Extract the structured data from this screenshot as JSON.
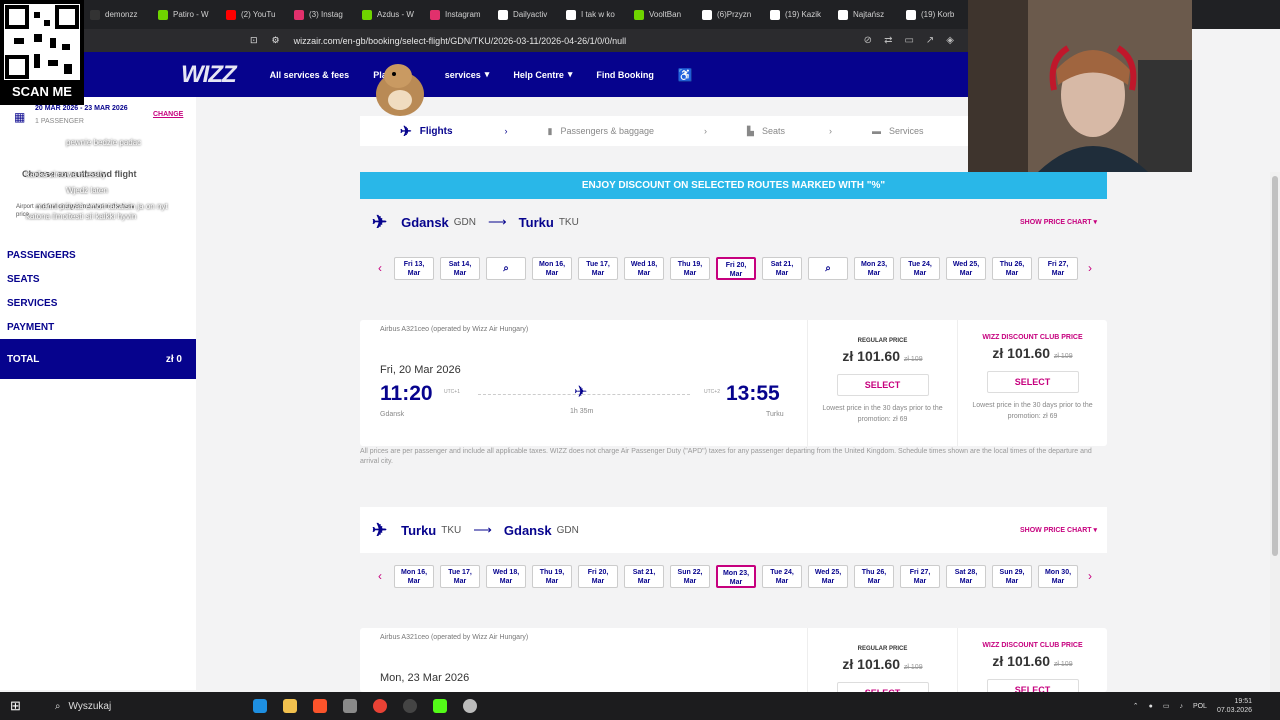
{
  "browser": {
    "tabs": [
      "demonzz",
      "Patiro - W",
      "(2) YouTu",
      "(3) Instag",
      "Azdus - W",
      "Instagram",
      "Dailyactiv",
      "I tak w ko",
      "VooltBan",
      "(6)Przyzn",
      "(19) Kazik",
      "Najtańsz",
      "(19) Korb"
    ],
    "tab_colors": [
      "#333",
      "#6fd400",
      "#ff0000",
      "#e1306c",
      "#6fd400",
      "#e1306c",
      "#fff",
      "#fff",
      "#6fd400",
      "#fff",
      "#fff",
      "#fff",
      "#fff"
    ],
    "url": "wizzair.com/en-gb/booking/select-flight/GDN/TKU/2026-03-11/2026-04-26/1/0/0/null"
  },
  "header": {
    "logo": "WIZZ",
    "nav": [
      "All services & fees",
      "Plan",
      "services",
      "Help Centre",
      "Find Booking"
    ],
    "accessibility_icon": "accessibility-icon"
  },
  "overlay": {
    "qr_label": "SCAN ME",
    "chat": [
      "pewnie bedzie padac",
      "Wjedź laten",
      "menni päivää emon takaisin ja on nyt",
      "katona ilmoitesti sii kaikki hyvin",
      "karika zimowa messity"
    ]
  },
  "sidebar": {
    "dates": "20 MAR 2026 - 23 MAR 2026",
    "passengers": "1 PASSENGER",
    "change": "CHANGE",
    "choose": "Choose an outbound flight",
    "fare_note": "Airport and fuel charges included in the base price",
    "sections": [
      "PASSENGERS",
      "SEATS",
      "SERVICES",
      "PAYMENT"
    ],
    "total_label": "TOTAL",
    "total_value": "zł 0"
  },
  "steps": [
    "Flights",
    "Passengers & baggage",
    "Seats",
    "Services"
  ],
  "banner": "ENJOY DISCOUNT ON SELECTED ROUTES MARKED WITH \"%\"",
  "outbound": {
    "from": "Gdansk",
    "from_code": "GDN",
    "to": "Turku",
    "to_code": "TKU",
    "chart_link": "SHOW PRICE CHART ▾",
    "dates": [
      "Fri 13,|Mar",
      "Sat 14,|Mar",
      "search",
      "Mon 16,|Mar",
      "Tue 17,|Mar",
      "Wed 18,|Mar",
      "Thu 19,|Mar",
      "Fri 20,|Mar",
      "Sat 21,|Mar",
      "search",
      "Mon 23,|Mar",
      "Tue 24,|Mar",
      "Wed 25,|Mar",
      "Thu 26,|Mar",
      "Fri 27,|Mar"
    ],
    "selected_index": 7
  },
  "flight1": {
    "operator": "Airbus A321ceo (operated by Wizz Air Hungary)",
    "date": "Fri, 20 Mar 2026",
    "dep_time": "11:20",
    "dep_tz": "UTC+1",
    "dep_city": "Gdansk",
    "arr_time": "13:55",
    "arr_tz": "UTC+2",
    "arr_city": "Turku",
    "duration": "1h 35m",
    "regular_label": "REGULAR PRICE",
    "club_label": "WIZZ DISCOUNT CLUB PRICE",
    "price": "zł 101.60",
    "old_price": "zł 109",
    "club_price": "zł 101.60",
    "club_old_price": "zł 109",
    "select": "SELECT",
    "lowest": "Lowest price in the 30 days prior to the promotion: zł 69"
  },
  "note": "All prices are per passenger and include all applicable taxes. WIZZ does not charge Air Passenger Duty (\"APD\") taxes for any passenger departing from the United Kingdom. Schedule times shown are the local times of the departure and arrival city.",
  "return": {
    "from": "Turku",
    "from_code": "TKU",
    "to": "Gdansk",
    "to_code": "GDN",
    "chart_link": "SHOW PRICE CHART ▾",
    "dates": [
      "Mon 16,|Mar",
      "Tue 17,|Mar",
      "Wed 18,|Mar",
      "Thu 19,|Mar",
      "Fri 20,|Mar",
      "Sat 21,|Mar",
      "Sun 22,|Mar",
      "Mon 23,|Mar",
      "Tue 24,|Mar",
      "Wed 25,|Mar",
      "Thu 26,|Mar",
      "Fri 27,|Mar",
      "Sat 28,|Mar",
      "Sun 29,|Mar",
      "Mon 30,|Mar"
    ],
    "selected_index": 7
  },
  "flight2": {
    "operator": "Airbus A321ceo (operated by Wizz Air Hungary)",
    "date": "Mon, 23 Mar 2026",
    "regular_label": "REGULAR PRICE",
    "club_label": "WIZZ DISCOUNT CLUB PRICE",
    "price": "zł 101.60",
    "old_price": "zł 109",
    "club_price": "zł 101.60",
    "club_old_price": "zł 109",
    "select": "SELECT"
  },
  "taskbar": {
    "search": "Wyszukaj",
    "lang": "POL",
    "time": "19:51",
    "date": "07.03.2026"
  }
}
